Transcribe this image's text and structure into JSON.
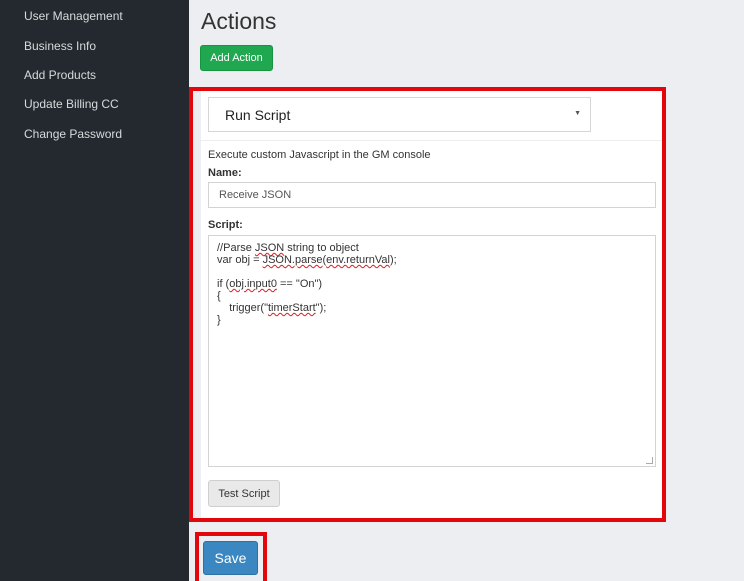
{
  "sidebar": {
    "items": [
      {
        "label": "User Management"
      },
      {
        "label": "Business Info"
      },
      {
        "label": "Add Products"
      },
      {
        "label": "Update Billing CC"
      },
      {
        "label": "Change Password"
      }
    ]
  },
  "main": {
    "title": "Actions",
    "add_action_label": "Add Action"
  },
  "action_panel": {
    "action_type": "Run Script",
    "description": "Execute custom Javascript in the GM console",
    "name_label": "Name:",
    "name_value": "Receive JSON",
    "script_label": "Script:",
    "script_lines": [
      "//Parse JSON string to object",
      "var obj = JSON.parse(env.returnVal);",
      "",
      "if (obj.input0 == \"On\")",
      "{",
      "    trigger(\"timerStart\");",
      "}"
    ],
    "test_button_label": "Test Script"
  },
  "footer": {
    "save_label": "Save"
  },
  "colors": {
    "sidebar_bg": "#23292e",
    "add_action_green": "#1fa84f",
    "save_blue": "#3a87c1",
    "highlight_red": "#e3060a"
  }
}
